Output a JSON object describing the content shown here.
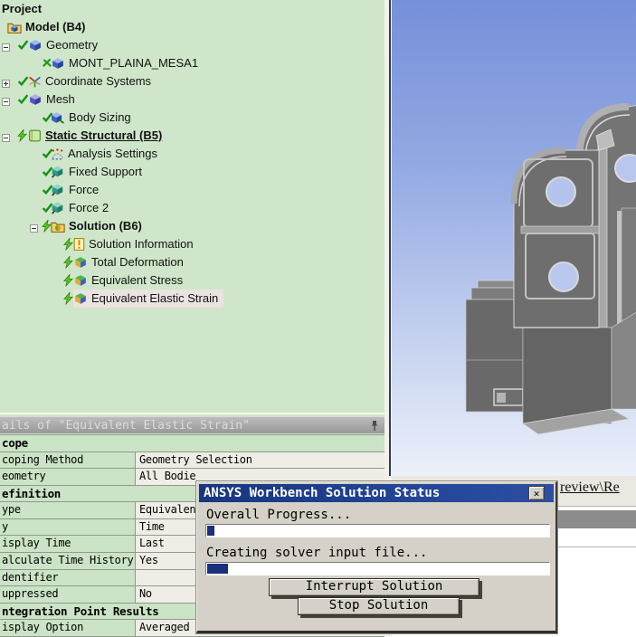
{
  "colors": {
    "tree_bg": "#cfe6ca",
    "selection_bg": "#eae3e0",
    "details_label_bg": "#cbe3c6",
    "details_value_bg": "#efede6",
    "dialog_bg": "#d5d1c8",
    "title_navy": "#1c3b8e",
    "progress_fill": "#1b2f80",
    "viewport_top": "#7690da",
    "viewport_bottom": "#ecf0fa"
  },
  "tree": {
    "items": [
      {
        "label": "Project",
        "level": 0,
        "bold": true,
        "icon": null,
        "status": null,
        "expand": null
      },
      {
        "label": "Model (B4)",
        "level": 1,
        "bold": true,
        "icon": "folder-model",
        "status": null,
        "expand": null
      },
      {
        "label": "Geometry",
        "level": 2,
        "icon": "cube-geometry",
        "status": "check",
        "expand": "minus"
      },
      {
        "label": "MONT_PLAINA_MESA1",
        "level": 3,
        "icon": "cube-part",
        "status": "x-mark",
        "expand": null
      },
      {
        "label": "Coordinate Systems",
        "level": 2,
        "icon": "axes",
        "status": "check",
        "expand": "plus"
      },
      {
        "label": "Mesh",
        "level": 2,
        "icon": "cube-mesh",
        "status": "check",
        "expand": "minus"
      },
      {
        "label": "Body Sizing",
        "level": 3,
        "icon": "cube-sizing",
        "status": "check",
        "expand": null
      },
      {
        "label": "Static Structural (B5)",
        "level": 2,
        "bold": true,
        "underline": true,
        "icon": "page-static",
        "status": "bolt",
        "expand": "minus"
      },
      {
        "label": "Analysis Settings",
        "level": 3,
        "icon": "chart-settings",
        "status": "check",
        "expand": null
      },
      {
        "label": "Fixed Support",
        "level": 3,
        "icon": "cube-support",
        "status": "check",
        "expand": null
      },
      {
        "label": "Force",
        "level": 3,
        "icon": "cube-force",
        "status": "check",
        "expand": null
      },
      {
        "label": "Force 2",
        "level": 3,
        "icon": "cube-force",
        "status": "check",
        "expand": null
      },
      {
        "label": "Solution (B6)",
        "level": 3,
        "bold": true,
        "icon": "folder-solution",
        "status": "bolt",
        "expand": "minus"
      },
      {
        "label": "Solution Information",
        "level": 4,
        "icon": "page-info",
        "status": "bolt",
        "expand": null
      },
      {
        "label": "Total Deformation",
        "level": 4,
        "icon": "result-cube",
        "status": "bolt",
        "expand": null
      },
      {
        "label": "Equivalent Stress",
        "level": 4,
        "icon": "result-cube",
        "status": "bolt",
        "expand": null
      },
      {
        "label": "Equivalent Elastic Strain",
        "level": 4,
        "icon": "result-cube",
        "status": "bolt",
        "expand": null,
        "selected": true
      }
    ]
  },
  "details": {
    "title": "ails of \"Equivalent Elastic Strain\"",
    "pin_icon": "pin-icon",
    "rows": [
      {
        "type": "section",
        "label": "cope"
      },
      {
        "type": "row",
        "label": "coping Method",
        "value": "Geometry Selection"
      },
      {
        "type": "row",
        "label": "eometry",
        "value": "All Bodie"
      },
      {
        "type": "section",
        "label": "efinition"
      },
      {
        "type": "row",
        "label": "ype",
        "value": "Equivalen"
      },
      {
        "type": "row",
        "label": "y",
        "value": "Time"
      },
      {
        "type": "row",
        "label": "isplay Time",
        "value": "Last"
      },
      {
        "type": "row",
        "label": "alculate Time History",
        "value": "Yes"
      },
      {
        "type": "row",
        "label": "dentifier",
        "value": ""
      },
      {
        "type": "row",
        "label": "uppressed",
        "value": "No"
      },
      {
        "type": "section",
        "label": "ntegration Point Results"
      },
      {
        "type": "row",
        "label": "isplay Option",
        "value": "Averaged"
      }
    ]
  },
  "dialog": {
    "title": "ANSYS Workbench Solution Status",
    "close_icon": "close-icon",
    "close_glyph": "✕",
    "overall_label": "Overall Progress...",
    "overall_percent": 2,
    "task_label": "Creating solver input file...",
    "task_percent": 6,
    "interrupt_label": "Interrupt Solution",
    "stop_label": "Stop Solution"
  },
  "viewport": {
    "tab_fragment": "review\\Re"
  }
}
